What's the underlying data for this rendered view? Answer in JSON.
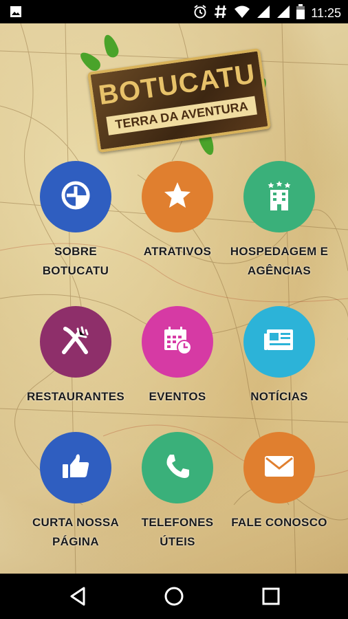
{
  "status_bar": {
    "time": "11:25",
    "icons": [
      "image-icon",
      "alarm-icon",
      "hash-icon",
      "wifi-icon",
      "signal-icon",
      "signal-icon",
      "battery-icon"
    ]
  },
  "logo": {
    "title": "BOTUCATU",
    "subtitle": "TERRA DA AVENTURA"
  },
  "menu": [
    {
      "label": "SOBRE BOTUCATU",
      "color": "#2f5ec0",
      "icon": "pie-chart-icon"
    },
    {
      "label": "ATRATIVOS",
      "color": "#e07f2f",
      "icon": "star-icon"
    },
    {
      "label": "HOSPEDAGEM E AGÊNCIAS",
      "color": "#3ab07a",
      "icon": "hotel-icon"
    },
    {
      "label": "RESTAURANTES",
      "color": "#8e2f6a",
      "icon": "fork-knife-icon"
    },
    {
      "label": "EVENTOS",
      "color": "#d63aa4",
      "icon": "calendar-icon"
    },
    {
      "label": "NOTÍCIAS",
      "color": "#2cb3d8",
      "icon": "newspaper-icon"
    },
    {
      "label": "CURTA NOSSA PÁGINA",
      "color": "#2f5ec0",
      "icon": "thumbs-up-icon"
    },
    {
      "label": "TELEFONES ÚTEIS",
      "color": "#3ab07a",
      "icon": "phone-icon"
    },
    {
      "label": "FALE CONOSCO",
      "color": "#e07f2f",
      "icon": "envelope-icon"
    }
  ],
  "nav_bar": [
    "back-icon",
    "home-icon",
    "recents-icon"
  ]
}
